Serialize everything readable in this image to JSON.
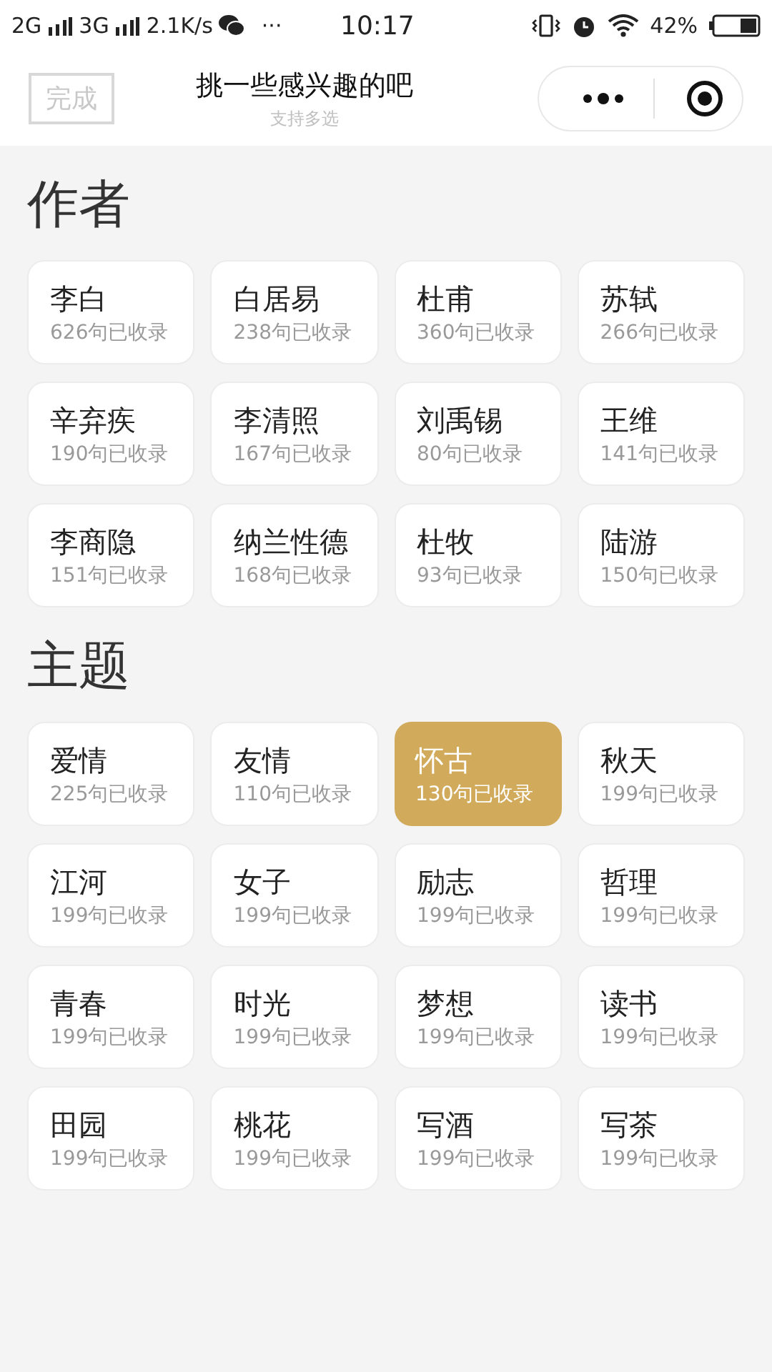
{
  "status_bar": {
    "network_1": "2G",
    "network_2": "3G",
    "speed": "2.1K/s",
    "more": "···",
    "time": "10:17",
    "battery": "42%"
  },
  "header": {
    "done_button": "完成",
    "title": "挑一些感兴趣的吧",
    "subtitle": "支持多选"
  },
  "sections": [
    {
      "title": "作者",
      "items": [
        {
          "name": "李白",
          "count": "626句已收录",
          "selected": false
        },
        {
          "name": "白居易",
          "count": "238句已收录",
          "selected": false
        },
        {
          "name": "杜甫",
          "count": "360句已收录",
          "selected": false
        },
        {
          "name": "苏轼",
          "count": "266句已收录",
          "selected": false
        },
        {
          "name": "辛弃疾",
          "count": "190句已收录",
          "selected": false
        },
        {
          "name": "李清照",
          "count": "167句已收录",
          "selected": false
        },
        {
          "name": "刘禹锡",
          "count": "80句已收录",
          "selected": false
        },
        {
          "name": "王维",
          "count": "141句已收录",
          "selected": false
        },
        {
          "name": "李商隐",
          "count": "151句已收录",
          "selected": false
        },
        {
          "name": "纳兰性德",
          "count": "168句已收录",
          "selected": false
        },
        {
          "name": "杜牧",
          "count": "93句已收录",
          "selected": false
        },
        {
          "name": "陆游",
          "count": "150句已收录",
          "selected": false
        }
      ]
    },
    {
      "title": "主题",
      "items": [
        {
          "name": "爱情",
          "count": "225句已收录",
          "selected": false
        },
        {
          "name": "友情",
          "count": "110句已收录",
          "selected": false
        },
        {
          "name": "怀古",
          "count": "130句已收录",
          "selected": true
        },
        {
          "name": "秋天",
          "count": "199句已收录",
          "selected": false
        },
        {
          "name": "江河",
          "count": "199句已收录",
          "selected": false
        },
        {
          "name": "女子",
          "count": "199句已收录",
          "selected": false
        },
        {
          "name": "励志",
          "count": "199句已收录",
          "selected": false
        },
        {
          "name": "哲理",
          "count": "199句已收录",
          "selected": false
        },
        {
          "name": "青春",
          "count": "199句已收录",
          "selected": false
        },
        {
          "name": "时光",
          "count": "199句已收录",
          "selected": false
        },
        {
          "name": "梦想",
          "count": "199句已收录",
          "selected": false
        },
        {
          "name": "读书",
          "count": "199句已收录",
          "selected": false
        },
        {
          "name": "田园",
          "count": "199句已收录",
          "selected": false
        },
        {
          "name": "桃花",
          "count": "199句已收录",
          "selected": false
        },
        {
          "name": "写酒",
          "count": "199句已收录",
          "selected": false
        },
        {
          "name": "写茶",
          "count": "199句已收录",
          "selected": false
        }
      ]
    }
  ]
}
